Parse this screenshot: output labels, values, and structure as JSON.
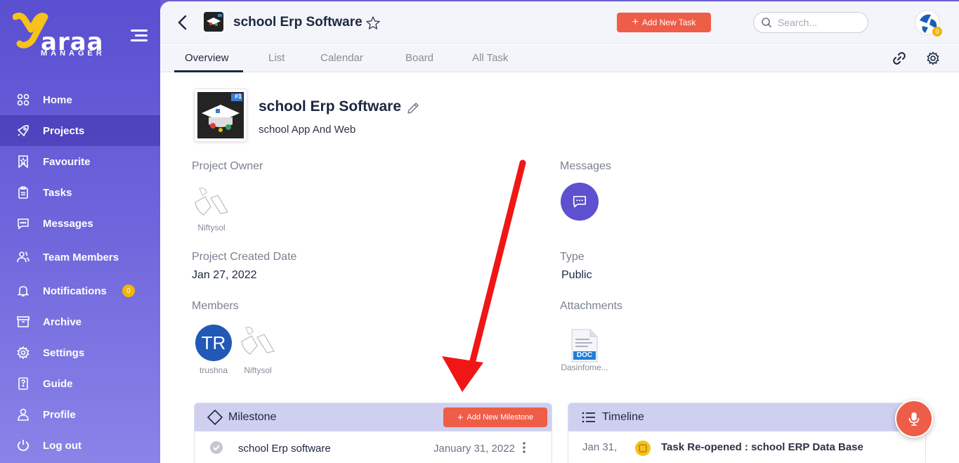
{
  "brand": {
    "logo_main": "araa",
    "logo_sub": "MANAGER"
  },
  "sidebar": {
    "items": [
      {
        "label": "Home",
        "icon": "home-grid-icon"
      },
      {
        "label": "Projects",
        "icon": "rocket-icon",
        "active": true
      },
      {
        "label": "Favourite",
        "icon": "bookmark-icon"
      },
      {
        "label": "Tasks",
        "icon": "clipboard-icon"
      },
      {
        "label": "Messages",
        "icon": "chat-icon"
      },
      {
        "label": "Team Members",
        "icon": "users-icon"
      },
      {
        "label": "Notifications",
        "icon": "bell-icon",
        "badge": "0"
      },
      {
        "label": "Archive",
        "icon": "archive-icon"
      },
      {
        "label": "Settings",
        "icon": "gear-icon"
      },
      {
        "label": "Guide",
        "icon": "guide-icon"
      },
      {
        "label": "Profile",
        "icon": "user-icon"
      },
      {
        "label": "Log out",
        "icon": "power-icon"
      }
    ]
  },
  "header": {
    "project_title": "school Erp Software",
    "add_task_label": "Add New Task",
    "search_placeholder": "Search...",
    "avatar_badge": "0"
  },
  "tabs": [
    {
      "label": "Overview",
      "active": true
    },
    {
      "label": "List"
    },
    {
      "label": "Calendar"
    },
    {
      "label": "Board"
    },
    {
      "label": "All Task"
    }
  ],
  "project": {
    "name": "school Erp Software",
    "description": "school App And Web",
    "thumb_badge": "#1"
  },
  "details": {
    "owner_label": "Project Owner",
    "owner_name": "Niftysol",
    "messages_label": "Messages",
    "created_label": "Project Created Date",
    "created_value": "Jan 27, 2022",
    "type_label": "Type",
    "type_value": "Public",
    "members_label": "Members",
    "members": [
      {
        "initials": "TR",
        "name": "trushna"
      },
      {
        "name": "Niftysol"
      }
    ],
    "attachments_label": "Attachments",
    "attachment_name": "Dasinfome...",
    "attachment_type": "DOC"
  },
  "milestone": {
    "title": "Milestone",
    "add_label": "Add New Milestone",
    "row_name": "school Erp software",
    "row_date": "January 31, 2022"
  },
  "timeline": {
    "title": "Timeline",
    "row_date": "Jan 31,",
    "row_text": "Task Re-opened : school ERP Data Base"
  },
  "colors": {
    "sidebar": "#5a4fd0",
    "accent_button": "#ee5d47",
    "badge": "#f2b705",
    "messages_button": "#5e50cf",
    "member_avatar": "#2159b5",
    "panel_header": "#cfd0f0",
    "annotation_arrow": "#f01616"
  }
}
